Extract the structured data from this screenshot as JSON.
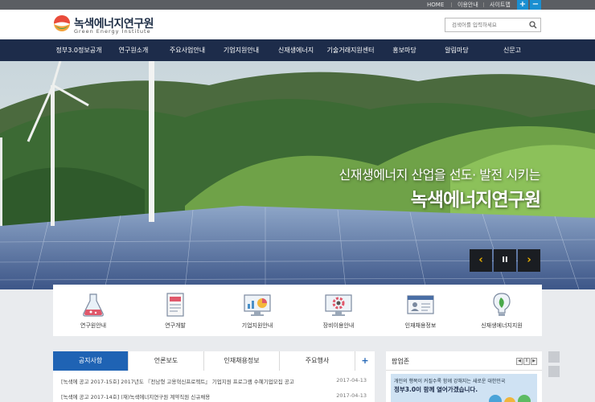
{
  "topbar": {
    "links": [
      "HOME",
      "이용안내",
      "사이트맵"
    ],
    "zoom_in": "+",
    "zoom_out": "−"
  },
  "header": {
    "logo_title": "녹색에너지연구원",
    "logo_subtitle": "Green Energy Institute",
    "search_placeholder": "검색어를 입력하세요"
  },
  "nav": {
    "items": [
      "정부3.0정보공개",
      "연구원소개",
      "주요사업안내",
      "기업지원안내",
      "신재생에너지",
      "기술거래지원센터",
      "홍보마당",
      "알림마당",
      "신문고"
    ]
  },
  "hero": {
    "line1": "신재생에너지 산업을 선도· 발전 시키는",
    "line2": "녹색에너지연구원",
    "prev": "‹",
    "pause": "II",
    "next": "›"
  },
  "quick_menu": [
    {
      "label": "연구원안내",
      "icon": "flask-icon"
    },
    {
      "label": "연구개발",
      "icon": "document-icon"
    },
    {
      "label": "기업지원안내",
      "icon": "monitor-chart-icon"
    },
    {
      "label": "장비이용안내",
      "icon": "equipment-gear-icon"
    },
    {
      "label": "인재채용정보",
      "icon": "id-card-icon"
    },
    {
      "label": "신재생에너지지원",
      "icon": "bulb-leaf-icon"
    }
  ],
  "board": {
    "tabs": [
      "공지사항",
      "언론보도",
      "인재채용정보",
      "주요행사"
    ],
    "more": "+",
    "posts": [
      {
        "title": "[녹색에 공고 2017-15호] 2017년도 『전남형 고용혁신프로젝트』 기업지원 프로그램 수혜기업모집 공고",
        "date": "2017-04-13"
      },
      {
        "title": "[녹색에 공고 2017-14호] (재)녹색에너지연구원 계약직원 신규채용",
        "date": "2017-04-13"
      }
    ]
  },
  "popup": {
    "title": "팝업존",
    "banner_line1": "개인의 행복이 커질수록 함께 강해지는 새로운 대한민국",
    "banner_line2": "정부3.0이 함께 열어가겠습니다."
  },
  "colors": {
    "nav_bg": "#1d2c4a",
    "accent_blue": "#1f63b4",
    "slider_arrow": "#f1b600",
    "topbar_bg": "#5b5e63"
  }
}
